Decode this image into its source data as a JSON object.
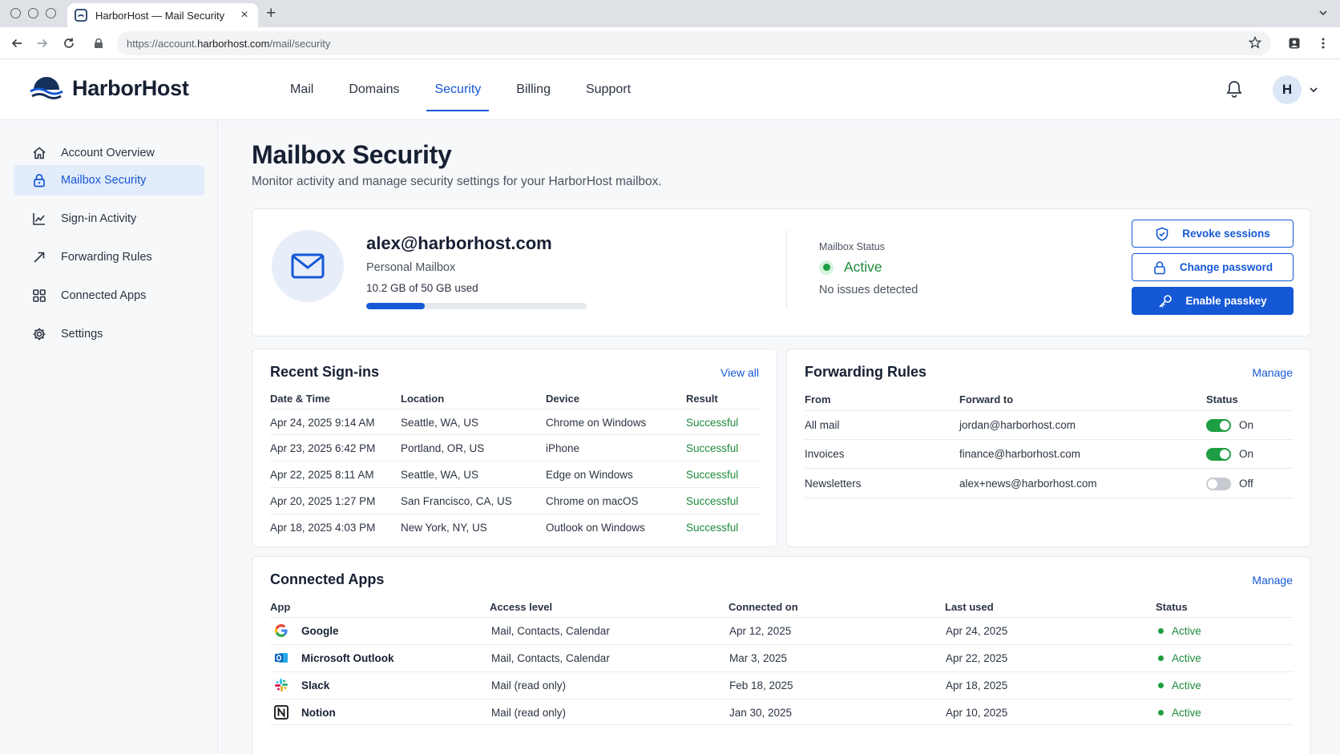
{
  "browser": {
    "tab_title": "HarborHost — Mail Security",
    "url_prefix": "https://account.",
    "url_host": "harborhost.com",
    "url_path": "/mail/security"
  },
  "brand": {
    "name": "HarborHost",
    "accent": "#1558d6"
  },
  "nav": {
    "items": [
      "Mail",
      "Domains",
      "Security",
      "Billing",
      "Support"
    ],
    "active": "Security"
  },
  "user": {
    "avatar_initial": "H"
  },
  "sidebar": {
    "items": [
      {
        "label": "Account Overview",
        "icon": "home-icon"
      },
      {
        "label": "Mailbox Security",
        "icon": "lock-icon",
        "active": true
      },
      {
        "label": "Sign-in Activity",
        "icon": "activity-chart-icon"
      },
      {
        "label": "Forwarding Rules",
        "icon": "forward-arrow-icon"
      },
      {
        "label": "Connected Apps",
        "icon": "apps-grid-icon"
      },
      {
        "label": "Settings",
        "icon": "gear-icon"
      }
    ]
  },
  "page": {
    "title": "Mailbox Security",
    "subtitle": "Monitor activity and manage security settings for your HarborHost mailbox."
  },
  "mailbox": {
    "email": "alex@harborhost.com",
    "type": "Personal Mailbox",
    "usage_text": "10.2 GB of 50 GB used",
    "usage_fraction": 0.265,
    "status_label": "Mailbox Status",
    "status_value": "Active",
    "status_note": "No issues detected"
  },
  "actions": {
    "revoke": "Revoke sessions",
    "change_password": "Change password",
    "enable_passkey": "Enable passkey"
  },
  "signins": {
    "title": "Recent Sign-ins",
    "link": "View all",
    "columns": [
      "Date & Time",
      "Location",
      "Device",
      "Result"
    ],
    "rows": [
      [
        "Apr 24, 2025 9:14 AM",
        "Seattle, WA, US",
        "Chrome on Windows",
        "Successful"
      ],
      [
        "Apr 23, 2025 6:42 PM",
        "Portland, OR, US",
        "iPhone",
        "Successful"
      ],
      [
        "Apr 22, 2025 8:11 AM",
        "Seattle, WA, US",
        "Edge on Windows",
        "Successful"
      ],
      [
        "Apr 20, 2025 1:27 PM",
        "San Francisco, CA, US",
        "Chrome on macOS",
        "Successful"
      ],
      [
        "Apr 18, 2025 4:03 PM",
        "New York, NY, US",
        "Outlook on Windows",
        "Successful"
      ]
    ]
  },
  "forwarding": {
    "title": "Forwarding Rules",
    "link": "Manage",
    "columns": [
      "From",
      "Forward to",
      "Status"
    ],
    "rows": [
      {
        "from": "All mail",
        "to": "jordan@harborhost.com",
        "on": true,
        "status": "On"
      },
      {
        "from": "Invoices",
        "to": "finance@harborhost.com",
        "on": true,
        "status": "On"
      },
      {
        "from": "Newsletters",
        "to": "alex+news@harborhost.com",
        "on": false,
        "status": "Off"
      }
    ]
  },
  "apps": {
    "title": "Connected Apps",
    "link": "Manage",
    "columns": [
      "App",
      "Access level",
      "Connected on",
      "Last used",
      "Status"
    ],
    "rows": [
      {
        "name": "Google",
        "icon": "google-logo-icon",
        "access": "Mail, Contacts, Calendar",
        "connected": "Apr 12, 2025",
        "last_used": "Apr 24, 2025",
        "status": "Active"
      },
      {
        "name": "Microsoft Outlook",
        "icon": "outlook-logo-icon",
        "access": "Mail, Contacts, Calendar",
        "connected": "Mar 3, 2025",
        "last_used": "Apr 22, 2025",
        "status": "Active"
      },
      {
        "name": "Slack",
        "icon": "slack-logo-icon",
        "access": "Mail (read only)",
        "connected": "Feb 18, 2025",
        "last_used": "Apr 18, 2025",
        "status": "Active"
      },
      {
        "name": "Notion",
        "icon": "notion-logo-icon",
        "access": "Mail (read only)",
        "connected": "Jan 30, 2025",
        "last_used": "Apr 10, 2025",
        "status": "Active"
      }
    ]
  }
}
